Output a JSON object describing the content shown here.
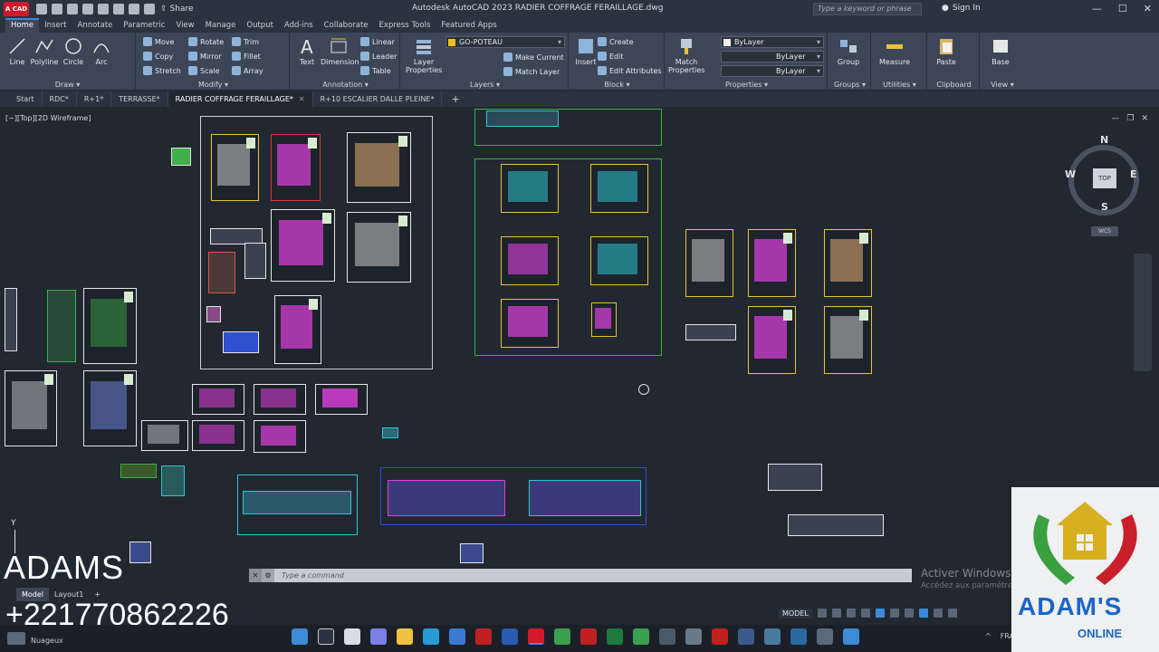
{
  "titlebar": {
    "app_logo": "A CAD",
    "share_label": "Share",
    "title": "Autodesk AutoCAD 2023   RADIER  COFFRAGE FERAILLAGE.dwg",
    "search_placeholder": "Type a keyword or phrase",
    "signin_label": "Sign In",
    "minimize": "—",
    "maximize": "☐",
    "close": "✕"
  },
  "ribbon_tabs": [
    "Home",
    "Insert",
    "Annotate",
    "Parametric",
    "View",
    "Manage",
    "Output",
    "Add-ins",
    "Collaborate",
    "Express Tools",
    "Featured Apps"
  ],
  "ribbon": {
    "draw": {
      "title": "Draw ▾",
      "tools": [
        "Line",
        "Polyline",
        "Circle",
        "Arc"
      ]
    },
    "modify": {
      "title": "Modify ▾",
      "tools": [
        "Move",
        "Rotate",
        "Trim",
        "Copy",
        "Mirror",
        "Fillet",
        "Stretch",
        "Scale",
        "Array"
      ]
    },
    "annotation": {
      "title": "Annotation ▾",
      "tools": [
        "Text",
        "Dimension",
        "Linear",
        "Leader",
        "Table"
      ]
    },
    "layers": {
      "title": "Layers ▾",
      "layer_properties": "Layer Properties",
      "current_layer": "GO-POTEAU",
      "tools": [
        "Make Current",
        "Match Layer"
      ]
    },
    "block": {
      "title": "Block ▾",
      "insert": "Insert",
      "tools": [
        "Create",
        "Edit",
        "Edit Attributes"
      ]
    },
    "properties": {
      "title": "Properties ▾",
      "match": "Match Properties",
      "bylayer_color": "ByLayer",
      "bylayer_linetype": "ByLayer",
      "bylayer_lineweight": "ByLayer"
    },
    "groups": {
      "title": "Groups ▾",
      "group": "Group"
    },
    "utilities": {
      "title": "Utilities ▾",
      "measure": "Measure"
    },
    "clipboard": {
      "title": "Clipboard",
      "paste": "Paste"
    },
    "view": {
      "title": "View ▾",
      "base": "Base"
    }
  },
  "file_tabs": [
    "Start",
    "RDC*",
    "R+1*",
    "TERRASSE*",
    "RADIER  COFFRAGE FERAILLAGE*",
    "R+10 ESCALIER DALLE PLEINE*"
  ],
  "viewport": {
    "label": "[−][Top][2D Wireframe]",
    "viewcube": {
      "n": "N",
      "s": "S",
      "e": "E",
      "w": "W",
      "top": "TOP",
      "wcs": "WCS"
    },
    "y_axis": "Y"
  },
  "command": {
    "placeholder": "Type a command"
  },
  "layout_tabs": [
    "Model",
    "Layout1",
    "+"
  ],
  "status": {
    "model": "MODEL"
  },
  "watermark": {
    "title": "Activer Windows",
    "subtitle": "Accédez aux paramètres pour activer Windows."
  },
  "overlay": {
    "name": "ADAMS",
    "phone": "+221770862226"
  },
  "logo": {
    "name": "ADAM'S",
    "sub": "ONLINE"
  },
  "taskbar": {
    "weather": "Nuageux",
    "lang": "FRA"
  },
  "colors": {
    "accent": "#3d8bd6",
    "sheet_border": "#e8c23a",
    "magenta": "#e040e0",
    "cyan": "#2ec5d4",
    "frame_green": "#3fb04a"
  }
}
